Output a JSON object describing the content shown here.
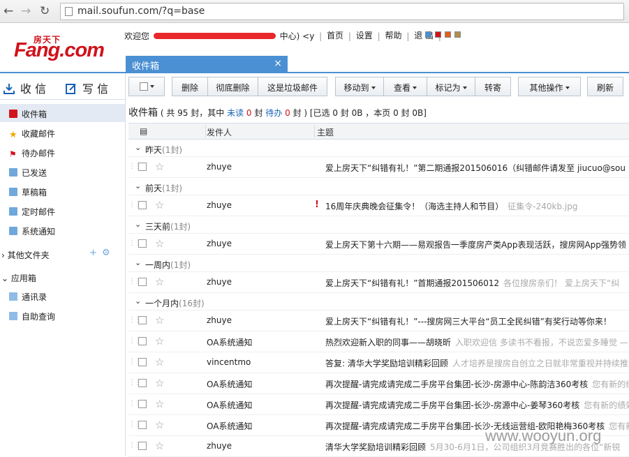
{
  "browser": {
    "url": "mail.soufun.com/?q=base"
  },
  "header": {
    "logo_cn": "房天下",
    "logo_text": "Fang.com",
    "welcome_prefix": "欢迎您",
    "welcome_suffix": "中心) <y",
    "links": [
      "首页",
      "设置",
      "帮助",
      "退 出"
    ],
    "skin_colors": [
      "#4a90d2",
      "#d0121b",
      "#e06020",
      "#b09050"
    ]
  },
  "tab": {
    "label": "收件箱",
    "close": "×"
  },
  "sidebar": {
    "receive_label": "收 信",
    "compose_label": "写 信",
    "folders": [
      {
        "label": "收件箱",
        "icon": "inbox-icon"
      },
      {
        "label": "收藏邮件",
        "icon": "star-icon"
      },
      {
        "label": "待办邮件",
        "icon": "flag-icon"
      },
      {
        "label": "已发送",
        "icon": "folder-icon"
      },
      {
        "label": "草稿箱",
        "icon": "folder-icon"
      },
      {
        "label": "定时邮件",
        "icon": "folder-icon"
      },
      {
        "label": "系统通知",
        "icon": "folder-icon"
      }
    ],
    "other_folders_label": "其他文件夹",
    "apps_label": "应用箱",
    "apps": [
      {
        "label": "通讯录",
        "icon": "contacts-icon"
      },
      {
        "label": "自助查询",
        "icon": "query-icon"
      }
    ]
  },
  "toolbar": {
    "buttons": [
      "删除",
      "彻底删除",
      "这是垃圾邮件",
      "移动到",
      "查看",
      "标记为",
      "转寄",
      "其他操作",
      "刷新"
    ]
  },
  "info": {
    "title": "收件箱",
    "p1": "( 共 95 封，其中",
    "unread_label": "未读",
    "unread_count": "0",
    "p2": "封",
    "todo_label": "待办",
    "todo_count": "0",
    "p3": "封 ) [已选 0 封 0B ，本页 0 封 0B]"
  },
  "list": {
    "col_from": "发件人",
    "col_subject": "主题",
    "groups": [
      {
        "label": "昨天",
        "count": "(1封)"
      },
      {
        "label": "前天",
        "count": "(1封)"
      },
      {
        "label": "三天前",
        "count": "(1封)"
      },
      {
        "label": "一周内",
        "count": "(1封)"
      },
      {
        "label": "一个月内",
        "count": "(16封)"
      }
    ],
    "rows": [
      {
        "from": "zhuye",
        "flag": "",
        "subject": "爱上房天下“纠错有礼！”第二期通报201506016（纠错邮件请发至 jiucuo@sou",
        "preview": ""
      },
      {
        "from": "zhuye",
        "flag": "!",
        "subject": "16周年庆典晚会征集令！（海选主持人和节目）",
        "preview": "征集令-240kb.jpg"
      },
      {
        "from": "zhuye",
        "flag": "",
        "subject": "爱上房天下第十六期——易观报告一季度房产类App表现活跃，搜房网App强势领",
        "preview": ""
      },
      {
        "from": "zhuye",
        "flag": "",
        "subject": "爱上房天下“纠错有礼！”首期通报201506012",
        "preview": "各位搜房亲们！ 爱上房天下“纠"
      },
      {
        "from": "zhuye",
        "flag": "",
        "subject": "爱上房天下“纠错有礼！”---搜房网三大平台“员工全民纠错”有奖行动等你来！",
        "preview": ""
      },
      {
        "from": "OA系统通知",
        "flag": "",
        "subject": "热烈欢迎新入职的同事——胡晓昕",
        "preview": "入职欢迎信 多读书不看报，不说恋爱多睡觉 —"
      },
      {
        "from": "vincentmo",
        "flag": "",
        "subject": "答复: 清华大学奖励培训精彩回顾",
        "preview": "人才培养是搜房自创立之日就非常重视并持续推动"
      },
      {
        "from": "OA系统通知",
        "flag": "",
        "subject": "再次提醒-请完成请完成二手房平台集团-长沙-房源中心-陈韵洁360考核",
        "preview": "您有新的绩"
      },
      {
        "from": "OA系统通知",
        "flag": "",
        "subject": "再次提醒-请完成请完成二手房平台集团-长沙-房源中心-姜琴360考核",
        "preview": "您有新的绩效"
      },
      {
        "from": "OA系统通知",
        "flag": "",
        "subject": "再次提醒-请完成请完成二手房平台集团-长沙-无线运营组-欧阳艳梅360考核",
        "preview": "您有新"
      },
      {
        "from": "zhuye",
        "flag": "",
        "subject": "清华大学奖励培训精彩回顾",
        "preview": "5月30-6月1日，公司组织3月竞赛胜出的各位“新锐"
      }
    ]
  },
  "watermark": "www.wooyun.org"
}
